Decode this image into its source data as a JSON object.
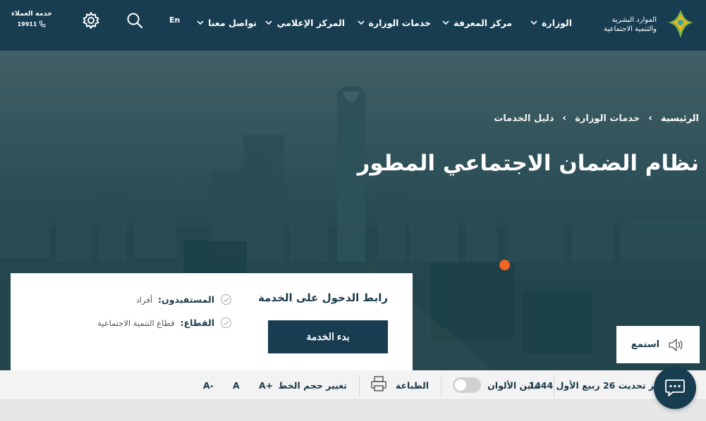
{
  "header": {
    "logo_line1": "الموارد البشرية",
    "logo_line2": "والتنمية الاجتماعية",
    "nav": [
      {
        "label": "الوزارة"
      },
      {
        "label": "مركز المعرفة"
      },
      {
        "label": "خدمات الوزارة"
      },
      {
        "label": "المركز الإعلامي"
      },
      {
        "label": "تواصل معنا"
      }
    ],
    "lang": "En",
    "customer_service": {
      "title": "خدمة العملاء",
      "number": "19911"
    }
  },
  "breadcrumb": [
    "الرئيسية",
    "خدمات الوزارة",
    "دليل الخدمات"
  ],
  "page_title": "نظام الضمان الاجتماعي المطور",
  "service_card": {
    "link_title": "رابط الدخول على الخدمة",
    "start_button": "بدء الخدمة",
    "beneficiaries_label": "المستفيدون:",
    "beneficiaries_value": "أفراد",
    "sector_label": "القطاع:",
    "sector_value": "قطاع التنمية الاجتماعية"
  },
  "listen_label": "استمع",
  "toolbar": {
    "last_update": "آخر تحديث 26 ربيع الأول 1444",
    "contrast_label": "تباين الألوان",
    "print_label": "الطباعة",
    "font_size_label": "تغيير حجم الخط",
    "font_increase": "A+",
    "font_normal": "A",
    "font_decrease": "A-"
  },
  "colors": {
    "primary": "#183d51",
    "accent": "#f06424",
    "logo_green": "#7ab648",
    "logo_yellow": "#f3b31c"
  },
  "icons": [
    "settings-icon",
    "search-icon",
    "phone-icon",
    "chevron-down-icon",
    "check-icon",
    "speaker-icon",
    "print-icon",
    "chat-icon"
  ]
}
